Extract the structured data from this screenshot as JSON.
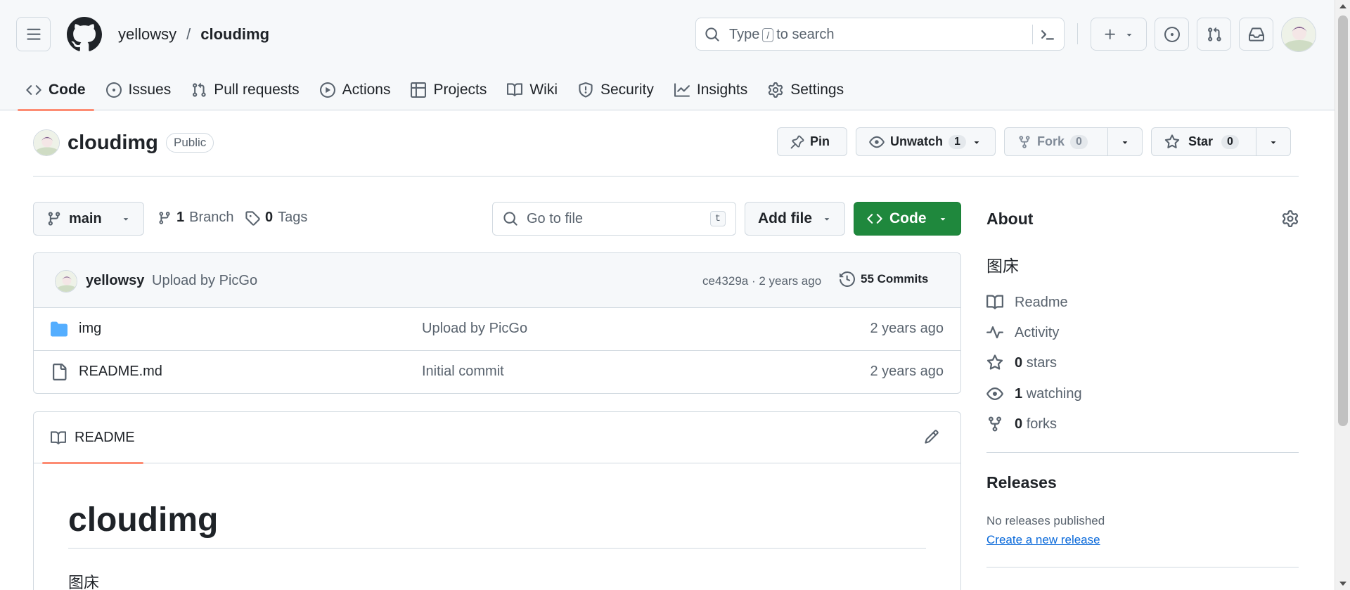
{
  "header": {
    "owner": "yellowsy",
    "separator": "/",
    "repo": "cloudimg",
    "search_text_before": "Type",
    "search_key": "/",
    "search_text_after": "to search"
  },
  "tabs": [
    {
      "label": "Code",
      "icon": "code-icon",
      "active": true
    },
    {
      "label": "Issues",
      "icon": "issue-icon"
    },
    {
      "label": "Pull requests",
      "icon": "pull-request-icon"
    },
    {
      "label": "Actions",
      "icon": "play-icon"
    },
    {
      "label": "Projects",
      "icon": "table-icon"
    },
    {
      "label": "Wiki",
      "icon": "book-icon"
    },
    {
      "label": "Security",
      "icon": "shield-icon"
    },
    {
      "label": "Insights",
      "icon": "graph-icon"
    },
    {
      "label": "Settings",
      "icon": "gear-icon"
    }
  ],
  "repo": {
    "name": "cloudimg",
    "visibility": "Public",
    "pin_label": "Pin",
    "unwatch_label": "Unwatch",
    "watch_count": "1",
    "fork_label": "Fork",
    "fork_count": "0",
    "star_label": "Star",
    "star_count": "0"
  },
  "filenav": {
    "branch": "main",
    "branch_count": "1",
    "branch_label": "Branch",
    "tag_count": "0",
    "tag_label": "Tags",
    "goto_placeholder": "Go to file",
    "goto_key": "t",
    "add_file_label": "Add file",
    "code_label": "Code"
  },
  "latest_commit": {
    "author": "yellowsy",
    "message": "Upload by PicGo",
    "meta": "ce4329a · 2 years ago",
    "commits": "55 Commits"
  },
  "files": [
    {
      "name": "img",
      "type": "folder",
      "message": "Upload by PicGo",
      "age": "2 years ago"
    },
    {
      "name": "README.md",
      "type": "file",
      "message": "Initial commit",
      "age": "2 years ago"
    }
  ],
  "readme": {
    "tab_label": "README",
    "heading": "cloudimg",
    "body": "图床"
  },
  "about": {
    "title": "About",
    "description": "图床",
    "readme": "Readme",
    "activity": "Activity",
    "stars_count": "0",
    "stars_label": "stars",
    "watching_count": "1",
    "watching_label": "watching",
    "forks_count": "0",
    "forks_label": "forks"
  },
  "releases": {
    "title": "Releases",
    "none_text": "No releases published",
    "create_link": "Create a new release"
  },
  "colors": {
    "accent_underline": "#fd8c73",
    "code_button": "#1f883d",
    "link": "#0969da",
    "folder": "#54aeff"
  }
}
